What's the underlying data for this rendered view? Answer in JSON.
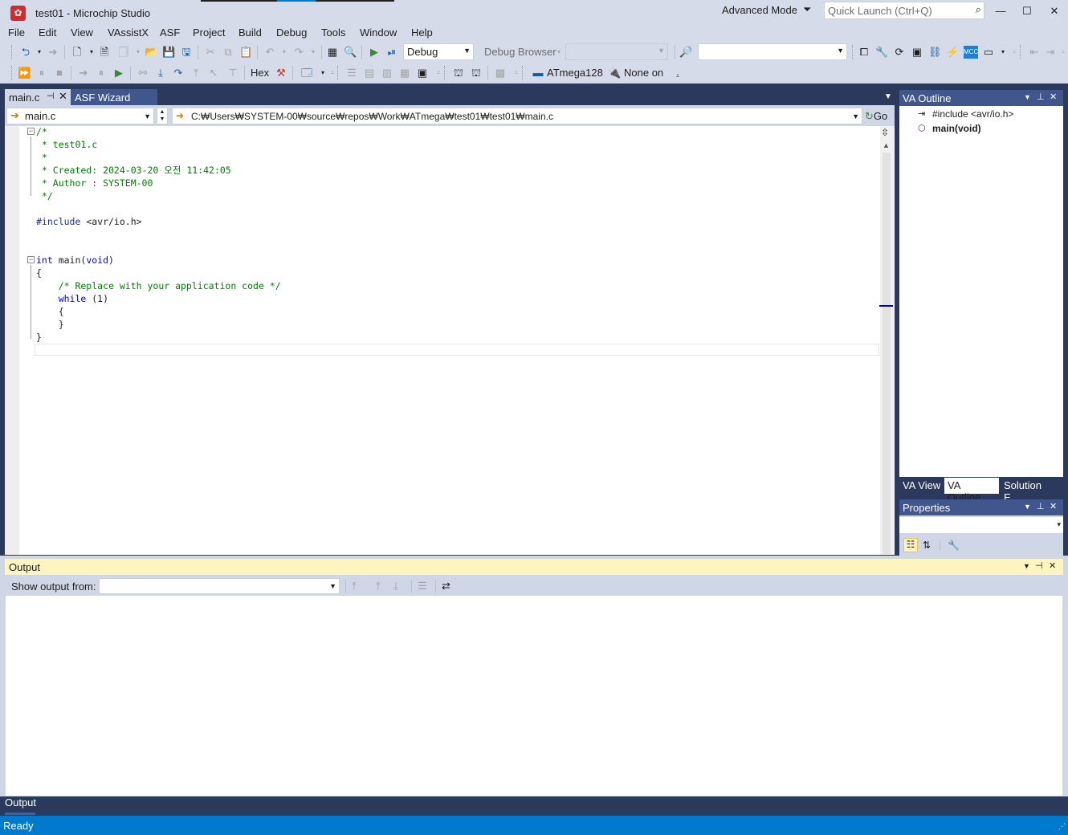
{
  "window": {
    "title": "test01 - Microchip Studio",
    "mode_label": "Advanced Mode",
    "quick_launch_placeholder": "Quick Launch (Ctrl+Q)",
    "controls": [
      "minimize",
      "maximize",
      "close"
    ]
  },
  "menu": [
    "File",
    "Edit",
    "View",
    "VAssistX",
    "ASF",
    "Project",
    "Build",
    "Debug",
    "Tools",
    "Window",
    "Help"
  ],
  "toolbar1": {
    "configuration": "Debug",
    "debug_browser": "Debug Browser"
  },
  "toolbar2": {
    "hex_label": "Hex",
    "device": "ATmega128",
    "tool": "None on"
  },
  "tabs": {
    "active": "main.c",
    "second": "ASF Wizard"
  },
  "navigation": {
    "file": "main.c",
    "path": "C:₩Users₩SYSTEM-00₩source₩repos₩Work₩ATmega₩test01₩test01₩main.c",
    "go_label": "Go"
  },
  "code": {
    "l1": "/*",
    "l2": " * test01.c",
    "l3": " *",
    "l4": " * Created: 2024-03-20 오전 11:42:05",
    "l5": " * Author : SYSTEM-00",
    "l6": " */",
    "l8_kw": "#include",
    "l8_rest": " <avr/io.h>",
    "l11_kw": "int",
    "l11_mid": " main(",
    "l11_kw2": "void",
    "l11_end": ")",
    "l12": "{",
    "l13": "    /* Replace with your application code */",
    "l14_kw": "    while",
    "l14_rest": " (1)",
    "l15": "    {",
    "l16": "    }",
    "l17": "}"
  },
  "va_outline": {
    "title": "VA Outline",
    "nodes": [
      "#include <avr/io.h>",
      "main(void)"
    ],
    "tabs": [
      "VA View",
      "VA Outline",
      "Solution E..."
    ]
  },
  "properties": {
    "title": "Properties"
  },
  "output": {
    "title": "Output",
    "show_from_label": "Show output from:",
    "bottom_tab": "Output"
  },
  "status": {
    "text": "Ready"
  },
  "colors": {
    "accent": "#007acc",
    "panel_header": "#40568d",
    "background": "#2b3a5c",
    "output_header": "#fdf4bf"
  }
}
